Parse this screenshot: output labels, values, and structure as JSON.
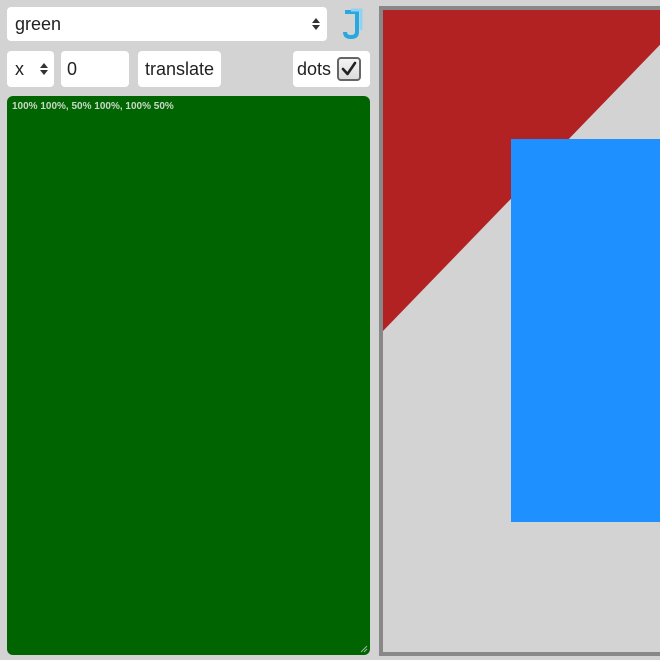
{
  "toolbar": {
    "shape_select": {
      "value": "green"
    },
    "axis_select": {
      "value": "x"
    },
    "amount_input": {
      "value": "0"
    },
    "translate_label": "translate",
    "dots_label": "dots",
    "dots_checked": true
  },
  "editor": {
    "text": "100% 100%, 50% 100%, 100% 50%",
    "background": "#006400"
  },
  "stage": {
    "background": "#d3d3d3",
    "border_color": "#888888",
    "shapes": [
      {
        "name": "red-triangle",
        "color": "#b22222"
      },
      {
        "name": "blue-rectangle",
        "color": "#1e90ff"
      }
    ]
  },
  "icons": {
    "logo": "logo-icon",
    "select_arrows": "select-arrows-icon",
    "checkmark": "checkmark-icon"
  }
}
